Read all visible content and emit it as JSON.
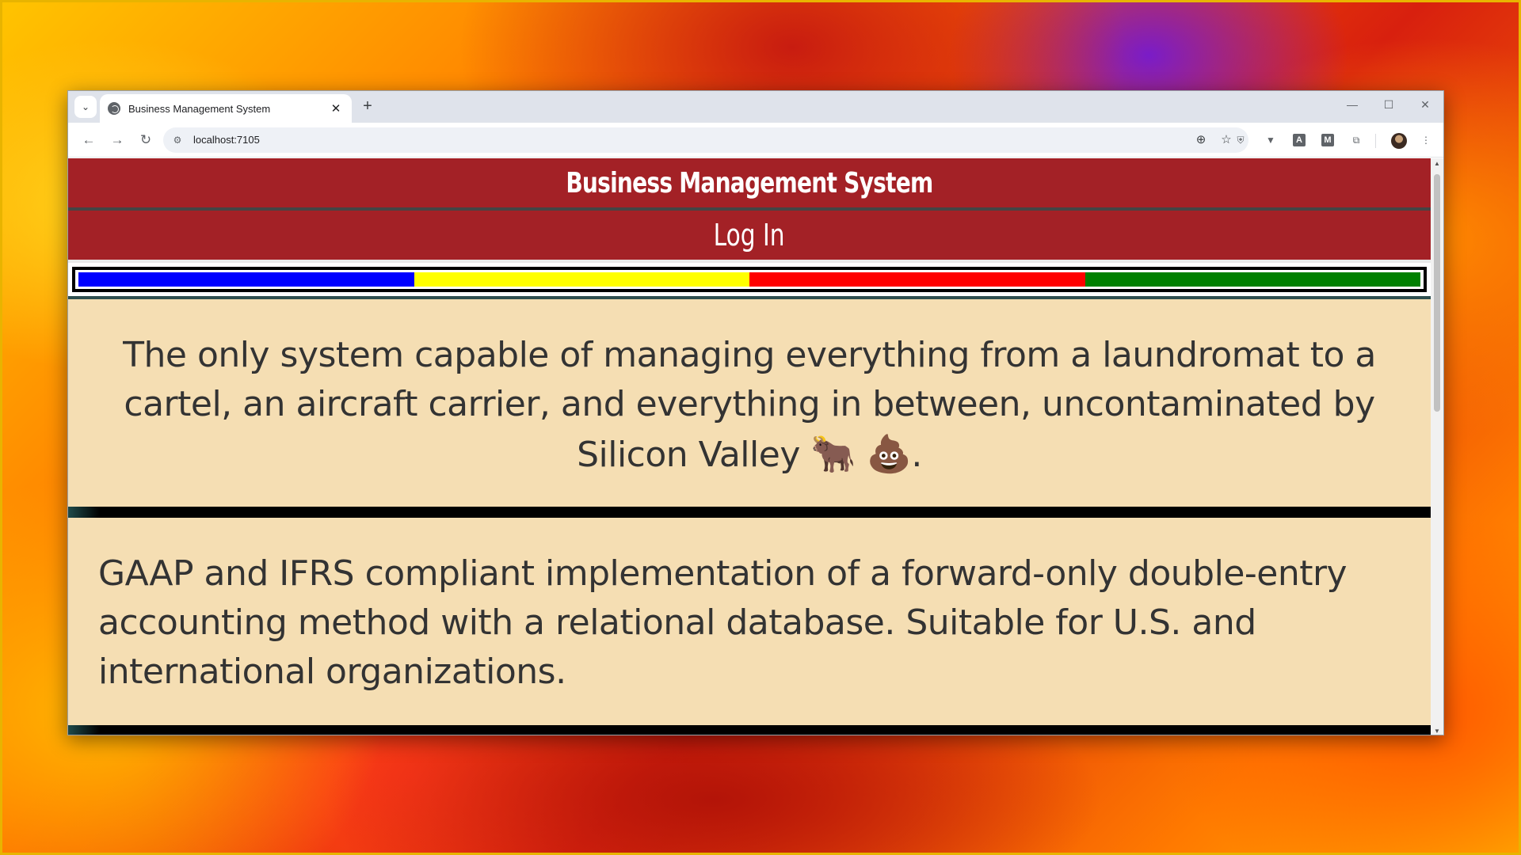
{
  "browser": {
    "tab_title": "Business Management System",
    "tab_close_glyph": "✕",
    "new_tab_glyph": "+",
    "url": "localhost:7105",
    "window_controls": [
      "—",
      "☐",
      "✕"
    ]
  },
  "page": {
    "header_title": "Business Management System",
    "login_label": "Log In",
    "color_strip": [
      "#0000ff",
      "#ffff00",
      "#ff0000",
      "#008000"
    ],
    "panel_1_text": "The only system capable of managing everything from a laundromat to a cartel, an aircraft carrier, and everything in between, uncontaminated by Silicon Valley",
    "panel_1_emoji_1": "🐂",
    "panel_1_emoji_2": "💩",
    "panel_1_end": ".",
    "panel_2_text": "GAAP and IFRS compliant implementation of a forward-only double-entry accounting method with a relational database. Suitable for U.S. and international organizations."
  },
  "colors": {
    "header_red": "#a32126",
    "panel_wheat": "#f5deb3",
    "text_dark": "#333333"
  },
  "icons": {
    "tab_search": "chevron-down-icon",
    "favicon": "globe-icon",
    "back": "back-arrow-icon",
    "forward": "forward-arrow-icon",
    "reload": "reload-icon",
    "site_info": "tune-icon",
    "zoom": "zoom-icon",
    "bookmark": "star-icon",
    "extensions": [
      "shield-extension-icon",
      "vue-extension-icon",
      "a-extension-icon",
      "m-extension-icon",
      "puzzle-icon"
    ],
    "menu": "kebab-menu-icon"
  }
}
